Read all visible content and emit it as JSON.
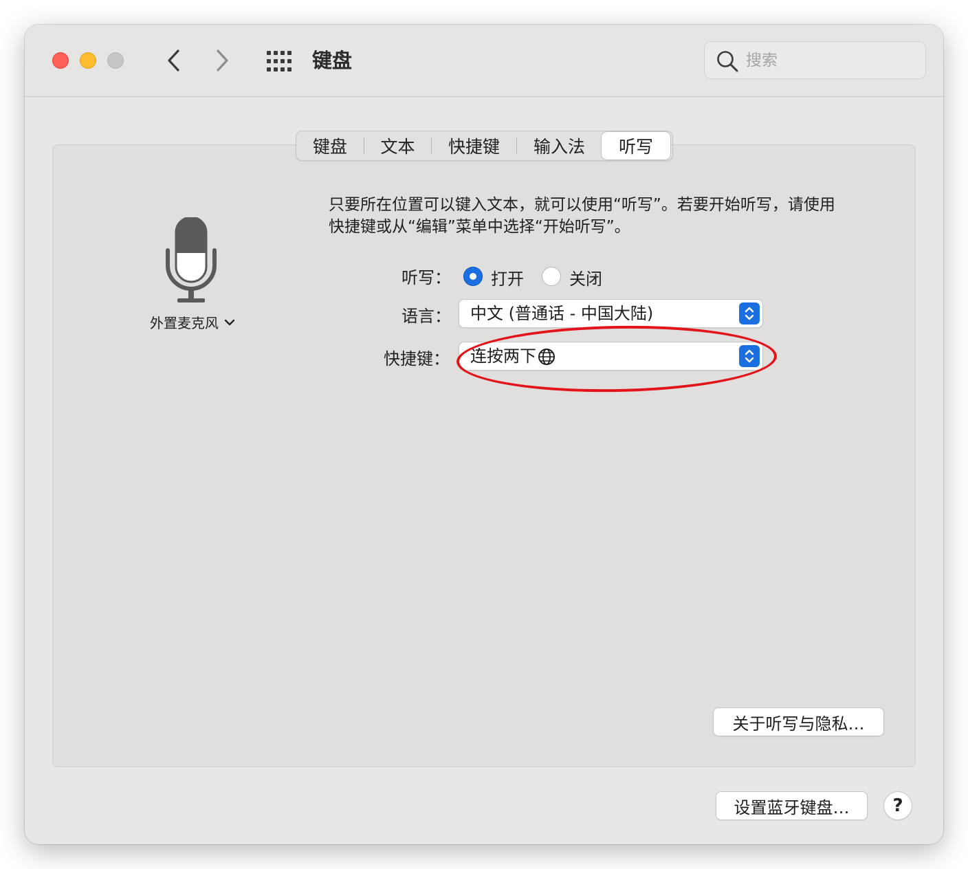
{
  "window": {
    "title": "键盘",
    "search_placeholder": "搜索"
  },
  "tabs": [
    {
      "label": "键盘"
    },
    {
      "label": "文本"
    },
    {
      "label": "快捷键"
    },
    {
      "label": "输入法"
    },
    {
      "label": "听写",
      "selected": true
    }
  ],
  "dictation": {
    "mic_source": "外置麦克风",
    "description": "只要所在位置可以键入文本，就可以使用“听写”。若要开始听写，请使用快捷键或从“编辑”菜单中选择“开始听写”。",
    "dictation_label": "听写：",
    "option_on": "打开",
    "option_off": "关闭",
    "selected_option": "打开",
    "language_label": "语言：",
    "language_value": "中文 (普通话 - 中国大陆)",
    "shortcut_label": "快捷键：",
    "shortcut_value": "连按两下",
    "shortcut_key_icon": "globe-icon",
    "about_button": "关于听写与隐私…"
  },
  "footer": {
    "bluetooth_button": "设置蓝牙键盘…",
    "help_button": "?"
  },
  "colors": {
    "accent": "#1b6fe0",
    "annotation": "#e2141a",
    "close": "#fe5f57",
    "minimize": "#febc2e"
  }
}
